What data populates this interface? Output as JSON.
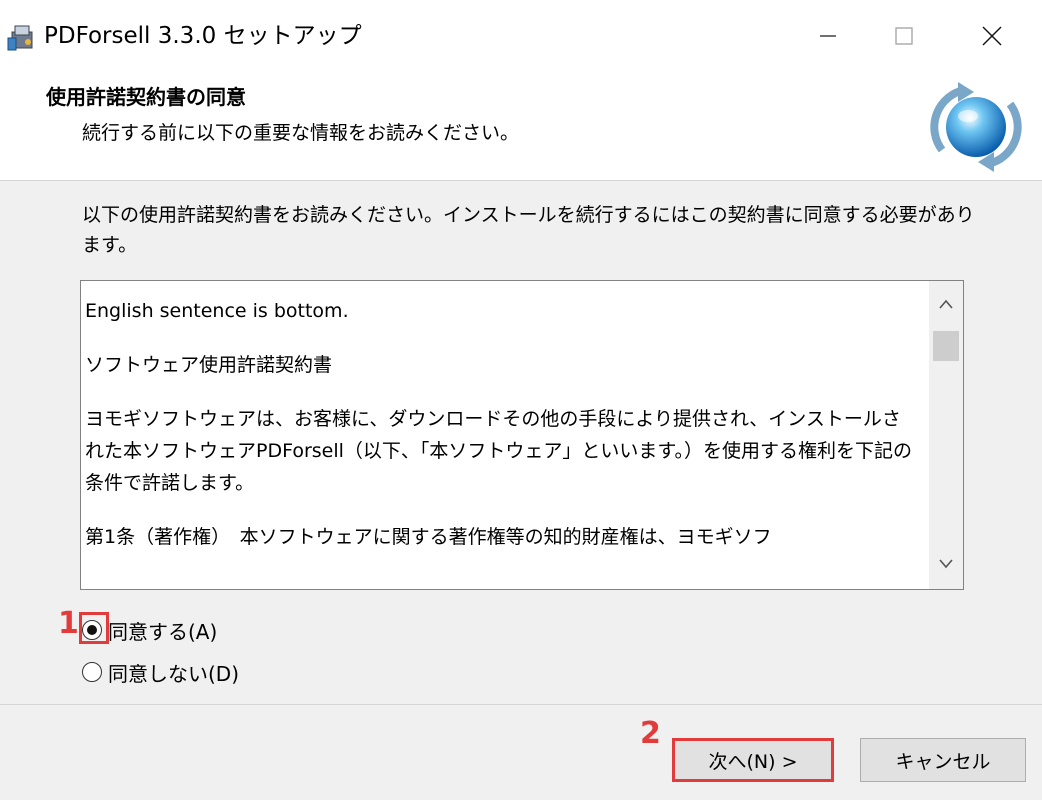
{
  "window": {
    "title": "PDForsell 3.3.0 セットアップ"
  },
  "header": {
    "title": "使用許諾契約書の同意",
    "subtitle": "続行する前に以下の重要な情報をお読みください。"
  },
  "intro_text": "以下の使用許諾契約書をお読みください。インストールを続行するにはこの契約書に同意する必要があります。",
  "license": {
    "paragraphs": [
      "English sentence is bottom.",
      "ソフトウェア使用許諾契約書",
      "ヨモギソフトウェアは、お客様に、ダウンロードその他の手段により提供され、インストールされた本ソフトウェアPDForsell（以下、「本ソフトウェア」といいます。）を使用する権利を下記の条件で許諾します。",
      "第1条（著作権）　本ソフトウェアに関する著作権等の知的財産権は、ヨモギソフ"
    ]
  },
  "options": {
    "agree_label": "同意する(A)",
    "disagree_label": "同意しない(D)",
    "selected": "agree"
  },
  "annotations": {
    "step1": "1",
    "step2": "2"
  },
  "buttons": {
    "next_label": "次へ(N) >",
    "cancel_label": "キャンセル"
  },
  "colors": {
    "highlight": "#e23b3b",
    "window_bg": "#f0f0f0"
  },
  "icons": {
    "app": "installer-icon",
    "logo": "globe-refresh-icon",
    "minimize": "minimize-icon",
    "maximize": "maximize-icon",
    "close": "close-icon",
    "scroll_up": "chevron-up-icon",
    "scroll_down": "chevron-down-icon"
  }
}
